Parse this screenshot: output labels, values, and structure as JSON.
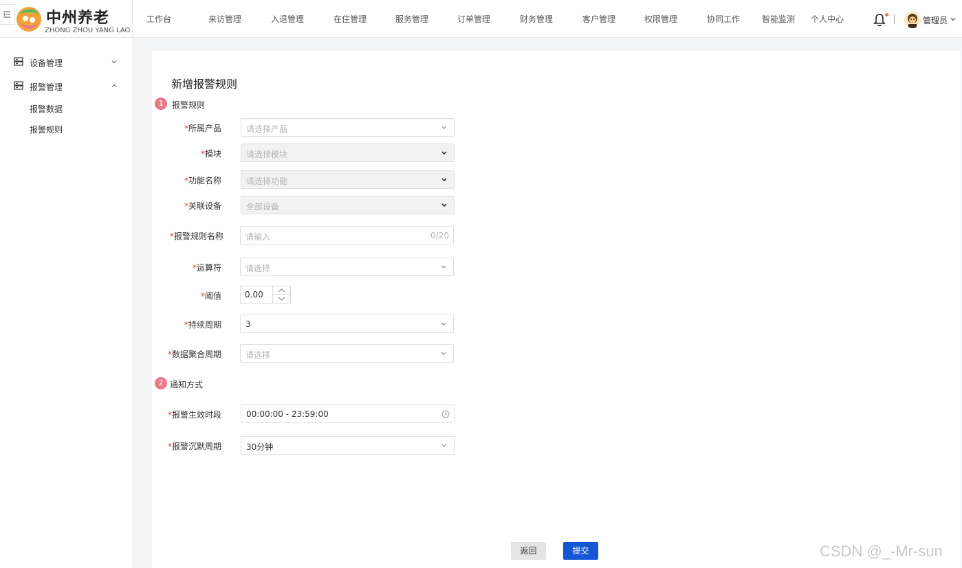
{
  "header": {
    "logo_title": "中州养老",
    "logo_subtitle": "ZHONG ZHOU YANG LAO",
    "nav_items": [
      "工作台",
      "来访管理",
      "入退管理",
      "在住管理",
      "服务管理",
      "订单管理",
      "财务管理",
      "客户管理",
      "权限管理",
      "协同工作",
      "智能监测",
      "个人中心"
    ],
    "user_name": "管理员"
  },
  "sidebar": {
    "groups": [
      {
        "label": "设备管理",
        "expanded": false
      },
      {
        "label": "报警管理",
        "expanded": true
      }
    ],
    "sub_items": [
      "报警数据",
      "报警规则"
    ]
  },
  "page": {
    "title": "新增报警规则",
    "sections": [
      {
        "number": "1",
        "title": "报警规则"
      },
      {
        "number": "2",
        "title": "通知方式"
      }
    ],
    "fields": {
      "product": {
        "label": "所属产品",
        "placeholder": "请选择产品"
      },
      "module": {
        "label": "模块",
        "placeholder": "请选择模块"
      },
      "function": {
        "label": "功能名称",
        "placeholder": "请选择功能"
      },
      "device": {
        "label": "关联设备",
        "placeholder": "全部设备"
      },
      "rule_name": {
        "label": "报警规则名称",
        "placeholder": "请输入",
        "counter": "0/20"
      },
      "operator": {
        "label": "运算符",
        "placeholder": "请选择"
      },
      "threshold": {
        "label": "阈值",
        "value": "0.00"
      },
      "duration": {
        "label": "持续周期",
        "value": "3"
      },
      "aggregation": {
        "label": "数据聚合周期",
        "placeholder": "请选择"
      },
      "effective_period": {
        "label": "报警生效时段",
        "value": "00:00:00 - 23:59:00"
      },
      "silence_period": {
        "label": "报警沉默周期",
        "value": "30分钟"
      }
    },
    "required_mark": "*",
    "buttons": {
      "back": "返回",
      "submit": "提交"
    }
  },
  "watermark": "CSDN @_-Mr-sun",
  "colors": {
    "primary": "#1556d4",
    "step_badge": "#e8788a",
    "required": "#e53935",
    "notification_dot": "#ff7a2e"
  }
}
